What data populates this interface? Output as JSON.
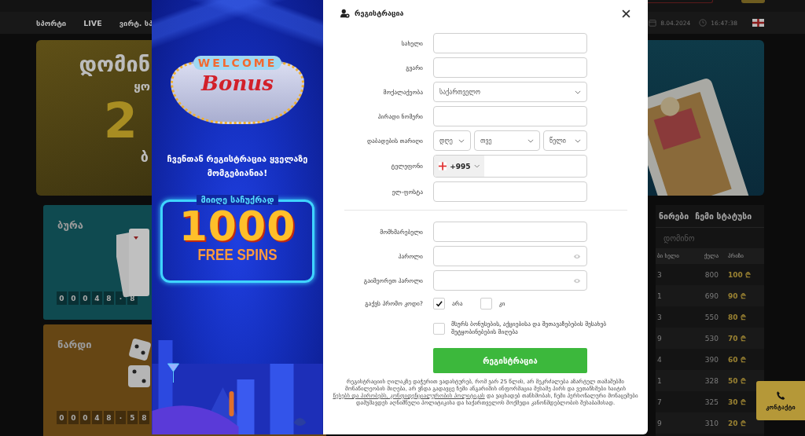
{
  "top_bar": {
    "buttons": [
      {
        "kind": "outline"
      },
      {
        "kind": "filled"
      }
    ]
  },
  "nav": {
    "items": [
      "სპორტი",
      "LIVE",
      "ვირტ. სპ"
    ],
    "date": "8.04.2024",
    "time": "16:47:38"
  },
  "hero": {
    "lines": [
      {
        "kind": "title",
        "text": "დომინ"
      },
      {
        "kind": "subtitle",
        "text": "ყო"
      },
      {
        "kind": "number",
        "text": "2"
      },
      {
        "kind": "caption",
        "text": "ბ"
      }
    ]
  },
  "games": [
    {
      "title": "ბურა",
      "color": "#0f4a50",
      "kind": "cards",
      "counter": [
        "0",
        "0",
        "0",
        "4",
        "8",
        "·",
        "8"
      ]
    },
    {
      "title": "ნარდი",
      "color": "#664614",
      "kind": "dice",
      "counter": [
        "0",
        "0",
        "0",
        "4",
        "8",
        "·",
        "5",
        "8"
      ]
    }
  ],
  "leaderboard": {
    "tabs": [
      "ნირები",
      "ჩემი სტატუსი"
    ],
    "game": "დომინო",
    "columns": [
      "ბი ხელი",
      "ქულა",
      "პრიზი"
    ],
    "rows": [
      {
        "rank": "3",
        "points": "800",
        "prize": "100 ₾"
      },
      {
        "rank": "1",
        "points": "690",
        "prize": "90 ₾"
      },
      {
        "rank": "3",
        "points": "550",
        "prize": "80 ₾"
      },
      {
        "rank": "9",
        "points": "530",
        "prize": "70 ₾"
      },
      {
        "rank": "4",
        "points": "390",
        "prize": "60 ₾"
      },
      {
        "rank": "1",
        "points": "328",
        "prize": "50 ₾"
      },
      {
        "rank": "7",
        "points": "325",
        "prize": "30 ₾"
      },
      {
        "rank": "9",
        "points": "310",
        "prize": "20 ₾"
      }
    ]
  },
  "contact_button": "კონტაქტი",
  "promo_banner": {
    "sign_top": "WELCOME",
    "sign_main": "Bonus",
    "headline": "ჩვენთან რეგისტრაცია ყველაზე მომგებიანია!",
    "offer_label": "მიიღე საჩუქრად",
    "offer_amount": "1000",
    "offer_unit": "FREE SPINS"
  },
  "registration": {
    "title": "რეგისტრაცია",
    "personal_fields": [
      {
        "kind": "text",
        "label": "სახელი"
      },
      {
        "kind": "text",
        "label": "გვარი"
      },
      {
        "kind": "select",
        "label": "მოქალაქეობა",
        "value": "საქართველო"
      },
      {
        "kind": "text",
        "label": "პირადი ნომერი"
      },
      {
        "kind": "date",
        "label": "დაბადების თარიღი",
        "parts": [
          "დღე",
          "თვე",
          "წელი"
        ]
      },
      {
        "kind": "phone",
        "label": "ტელეფონი",
        "code": "+995"
      },
      {
        "kind": "text",
        "label": "ელ-ფოსტა"
      }
    ],
    "account_fields": [
      {
        "kind": "text",
        "label": "მომხმარებელი"
      },
      {
        "kind": "password",
        "label": "პაროლი"
      },
      {
        "kind": "password",
        "label": "გაიმეორეთ პაროლი"
      }
    ],
    "promo": {
      "label": "გაქვს პრომო კოდი?",
      "options": [
        {
          "label": "არა",
          "selected": true
        },
        {
          "label": "კი",
          "selected": false
        }
      ]
    },
    "consent": {
      "text": "მსურს ბონუსების, აქციებისა და შეთავაზებების შესახებ შეტყობინებების მიღება",
      "checked": false
    },
    "submit": "რეგისტრაცია",
    "footer": [
      {
        "kind": "text",
        "text": "რეგისტრაციის ღილაკზე დაჭერით ვადასტურებ, რომ ვარ 25 წლის, არ მეკრძალება აზარტულ თამაშებში მონაწილეობის მიღება, არ ვნდა გადავცე ჩემი ანგარიშის ინფორმაცია მესამე პირს და ვეთანხმები საიტის "
      },
      {
        "kind": "link",
        "text": "წესებს და პირობებს, კონფიდენციალურობის პოლიტიკას"
      },
      {
        "kind": "text",
        "text": " და ვაცხადებ თანხმობას, ჩემი პერსონალური მონაცემები დამუშავდეს აღნიშნული პოლიტიკისა და საქართველოს მოქმედი კანონმდებლობის შესაბამისად."
      }
    ]
  }
}
